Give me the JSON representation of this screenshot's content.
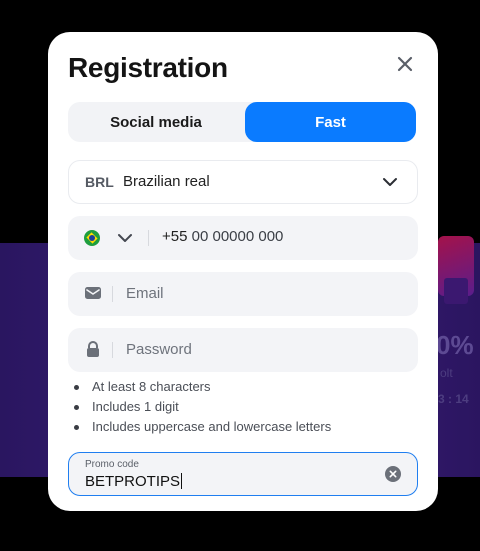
{
  "background": {
    "percent_text": "0%",
    "sub_text": "olt",
    "date_text": "3 : 14"
  },
  "modal": {
    "title": "Registration",
    "close_icon": "close-icon"
  },
  "tabs": [
    {
      "label": "Social media",
      "active": false
    },
    {
      "label": "Fast",
      "active": true
    }
  ],
  "currency": {
    "code": "BRL",
    "name": "Brazilian real"
  },
  "phone": {
    "country_flag": "brazil-flag-icon",
    "prefix": "+55",
    "mask": "00 00000 000"
  },
  "email": {
    "placeholder": "Email",
    "icon": "envelope-icon"
  },
  "password": {
    "placeholder": "Password",
    "icon": "lock-icon"
  },
  "password_rules": [
    "At least 8 characters",
    "Includes 1 digit",
    "Includes uppercase and lowercase letters"
  ],
  "promo": {
    "label": "Promo code",
    "value": "BETPROTIPS"
  },
  "colors": {
    "accent": "#0a7bff",
    "focus_border": "#1f7ef0",
    "field_bg": "#f3f4f7"
  }
}
